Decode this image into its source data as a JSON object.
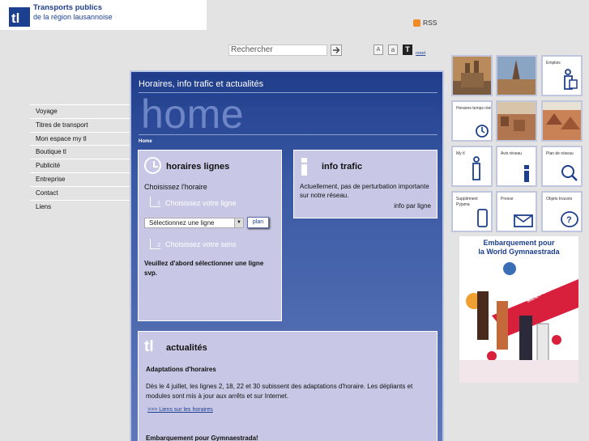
{
  "header": {
    "logo_mark": "tl",
    "brand_title": "Transports publics",
    "brand_subtitle": "de la région lausannoise",
    "rss_label": "RSS"
  },
  "search": {
    "placeholder": "Rechercher",
    "submit_icon": "arrow-right-icon"
  },
  "font_size": {
    "small": "A",
    "medium": "a",
    "large": "T",
    "reset": "reset"
  },
  "nav": {
    "items": [
      {
        "label": "Voyage"
      },
      {
        "label": "Titres de transport"
      },
      {
        "label": "Mon espace my tl"
      },
      {
        "label": "Boutique tl"
      },
      {
        "label": "Publicité"
      },
      {
        "label": "Entreprise"
      },
      {
        "label": "Contact"
      },
      {
        "label": "Liens"
      }
    ]
  },
  "main": {
    "title": "Horaires, info trafic et actualités",
    "home_word": "home",
    "breadcrumb": "Home"
  },
  "horaires": {
    "heading": "horaires lignes",
    "intro": "Choisissez l'horaire",
    "step1_number": "1",
    "step1_label": "Choisissez votre ligne",
    "select_value": "Sélectionnez une ligne",
    "plan_label": "plan",
    "step2_number": "2",
    "step2_label": "Choisissez votre sens",
    "warning": "Veuillez d'abord sélectionner une ligne svp."
  },
  "info_trafic": {
    "heading": "info trafic",
    "text": "Actuellement, pas de perturbation importante sur notre réseau.",
    "link": "info par ligne"
  },
  "actualites": {
    "logo": "tl",
    "heading": "actualités",
    "news_title": "Adaptations d'horaires",
    "news_body": "Dès le 4 juillet, les lignes  2, 18, 22 et 30 subissent des adaptations d'horaire. Les dépliants et modules sont mis à jour aux arrêts et sur Internet.",
    "news_link": ">>> Liens sur les horaires",
    "news2_title": "Embarquement pour Gymnaestrada!"
  },
  "tiles": [
    {
      "label": "",
      "icon": "cathedral-photo"
    },
    {
      "label": "",
      "icon": "church-tower-photo"
    },
    {
      "label": "Emplois",
      "icon": "person-id-icon"
    },
    {
      "label": "Horaires temps réel",
      "icon": "clock-icon"
    },
    {
      "label": "",
      "icon": "city-photo"
    },
    {
      "label": "",
      "icon": "rooftops-photo"
    },
    {
      "label": "My tl",
      "icon": "person-badge-icon"
    },
    {
      "label": "Avis réseau",
      "icon": "info-icon"
    },
    {
      "label": "Plan de réseau",
      "icon": "magnifier-icon"
    },
    {
      "label": "Supplément Pyjama",
      "icon": "phone-icon"
    },
    {
      "label": "Presse",
      "icon": "envelope-icon"
    },
    {
      "label": "Objets trouvés",
      "icon": "question-bubble-icon"
    }
  ],
  "ad": {
    "title_line1": "Embarquement pour",
    "title_line2": "la World Gymnaestrada",
    "meet_text": "MEET THE MAGIC !"
  },
  "colors": {
    "brand_blue": "#1d3f8f",
    "panel_bg": "#c8c8e6",
    "main_bg_top": "#1f3d8a",
    "rss_orange": "#f08a24"
  }
}
